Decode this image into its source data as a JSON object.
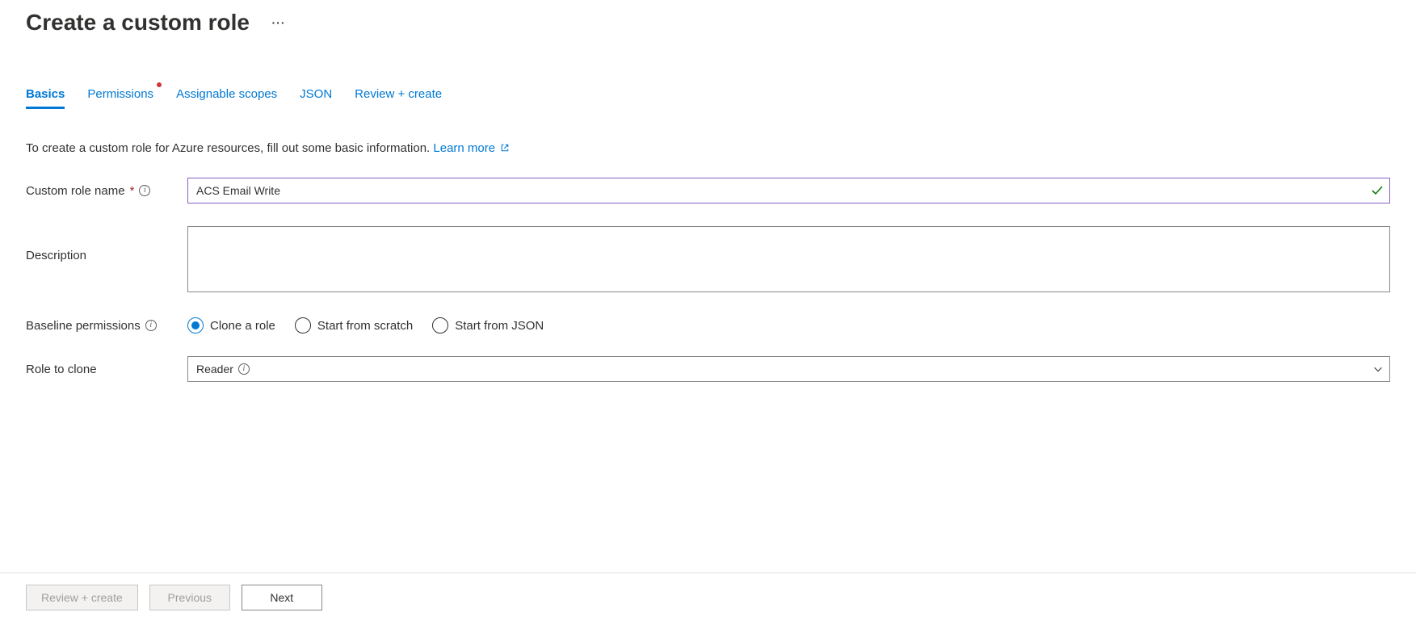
{
  "header": {
    "title": "Create a custom role"
  },
  "tabs": [
    {
      "label": "Basics",
      "active": true,
      "dot": false
    },
    {
      "label": "Permissions",
      "active": false,
      "dot": true
    },
    {
      "label": "Assignable scopes",
      "active": false,
      "dot": false
    },
    {
      "label": "JSON",
      "active": false,
      "dot": false
    },
    {
      "label": "Review + create",
      "active": false,
      "dot": false
    }
  ],
  "intro": {
    "text": "To create a custom role for Azure resources, fill out some basic information. ",
    "link_text": "Learn more"
  },
  "form": {
    "role_name": {
      "label": "Custom role name",
      "value": "ACS Email Write"
    },
    "description": {
      "label": "Description",
      "value": ""
    },
    "baseline": {
      "label": "Baseline permissions",
      "options": [
        {
          "label": "Clone a role",
          "checked": true
        },
        {
          "label": "Start from scratch",
          "checked": false
        },
        {
          "label": "Start from JSON",
          "checked": false
        }
      ]
    },
    "role_to_clone": {
      "label": "Role to clone",
      "value": "Reader"
    }
  },
  "footer": {
    "review_create": "Review + create",
    "previous": "Previous",
    "next": "Next"
  }
}
